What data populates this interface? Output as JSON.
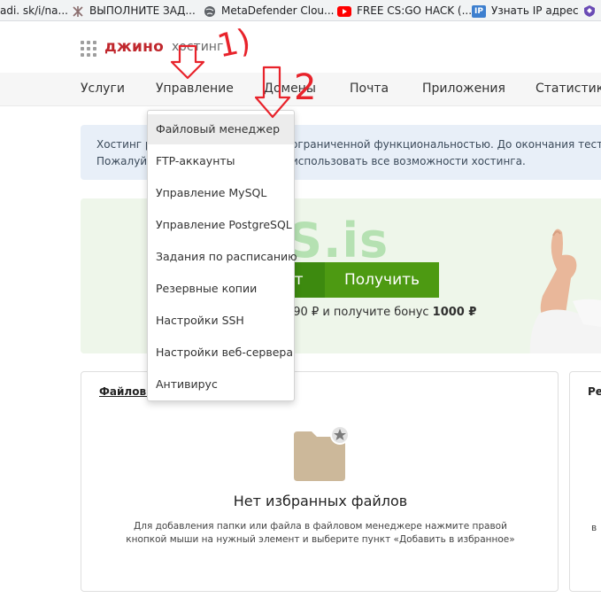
{
  "bookmarks": [
    {
      "label": "adi. sk/i/na...",
      "icon": "page-icon"
    },
    {
      "label": "ВЫПОЛНИТЕ ЗАД...",
      "icon": "knot-icon"
    },
    {
      "label": "MetaDefender Clou...",
      "icon": "globe-icon"
    },
    {
      "label": "FREE CS:GO HACK (...",
      "icon": "youtube-icon"
    },
    {
      "label": "Узнать IP адрес",
      "icon": "ip-icon",
      "icon_text": "IP"
    },
    {
      "label": "",
      "icon": "shield-icon"
    }
  ],
  "header": {
    "logo": "джино",
    "logo_sub": "хостинг"
  },
  "nav": {
    "items": [
      "Услуги",
      "Управление",
      "Домены",
      "Почта",
      "Приложения",
      "Статистика"
    ]
  },
  "notice": {
    "left_line1": "Хостинг р",
    "left_line2": "Пожалуй",
    "right_line1": "ограниченной функциональностью. До окончания тестово",
    "right_line2": "использовать все возможности хостинга."
  },
  "promo": {
    "dark_label": "нет",
    "button": "Получить",
    "bonus_prefix": "990 ₽ и получите бонус ",
    "bonus_amount": "1000 ₽",
    "watermark": "XSS.is"
  },
  "favorites_card": {
    "title": "Файловы",
    "empty_title": "Нет избранных файлов",
    "empty_line1": "Для добавления папки или файла в файловом менеджере нажмите правой",
    "empty_line2": "кнопкой мыши на нужный элемент и выберите пункт «Добавить в избранное»"
  },
  "right_card": {
    "title": "Ре",
    "fragment": "в"
  },
  "dropdown": {
    "items": [
      "Файловый менеджер",
      "FTP-аккаунты",
      "Управление MySQL",
      "Управление PostgreSQL",
      "Задания по расписанию",
      "Резервные копии",
      "Настройки SSH",
      "Настройки веб-сервера",
      "Антивирус"
    ],
    "active_index": 0
  },
  "annotations": {
    "label_1": "1)",
    "label_2": "2"
  },
  "colors": {
    "brand": "#c0272d",
    "promo_button": "#4d9a12",
    "annotation": "#e8232b"
  }
}
